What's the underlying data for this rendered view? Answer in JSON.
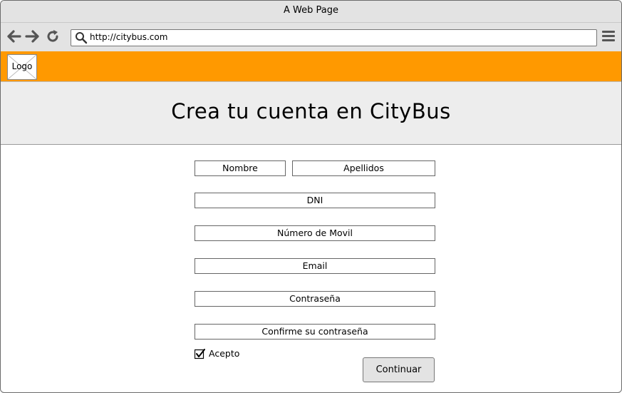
{
  "window": {
    "title": "A Web Page"
  },
  "browser": {
    "url": "http://citybus.com",
    "icons": {
      "back": "arrow-left-icon",
      "forward": "arrow-right-icon",
      "reload": "reload-icon",
      "search": "search-icon",
      "menu": "hamburger-menu-icon"
    }
  },
  "header": {
    "logo_label": "Logo",
    "background_color": "#ff9900"
  },
  "hero": {
    "title": "Crea tu cuenta en CityBus"
  },
  "form": {
    "first_name": "Nombre",
    "last_name": "Apellidos",
    "dni": "DNI",
    "phone": "Número de Movil",
    "email": "Email",
    "password": "Contraseña",
    "password_confirm": "Confirme su contraseña",
    "accept_label": "Acepto",
    "accept_checked": true,
    "continue_label": "Continuar"
  }
}
